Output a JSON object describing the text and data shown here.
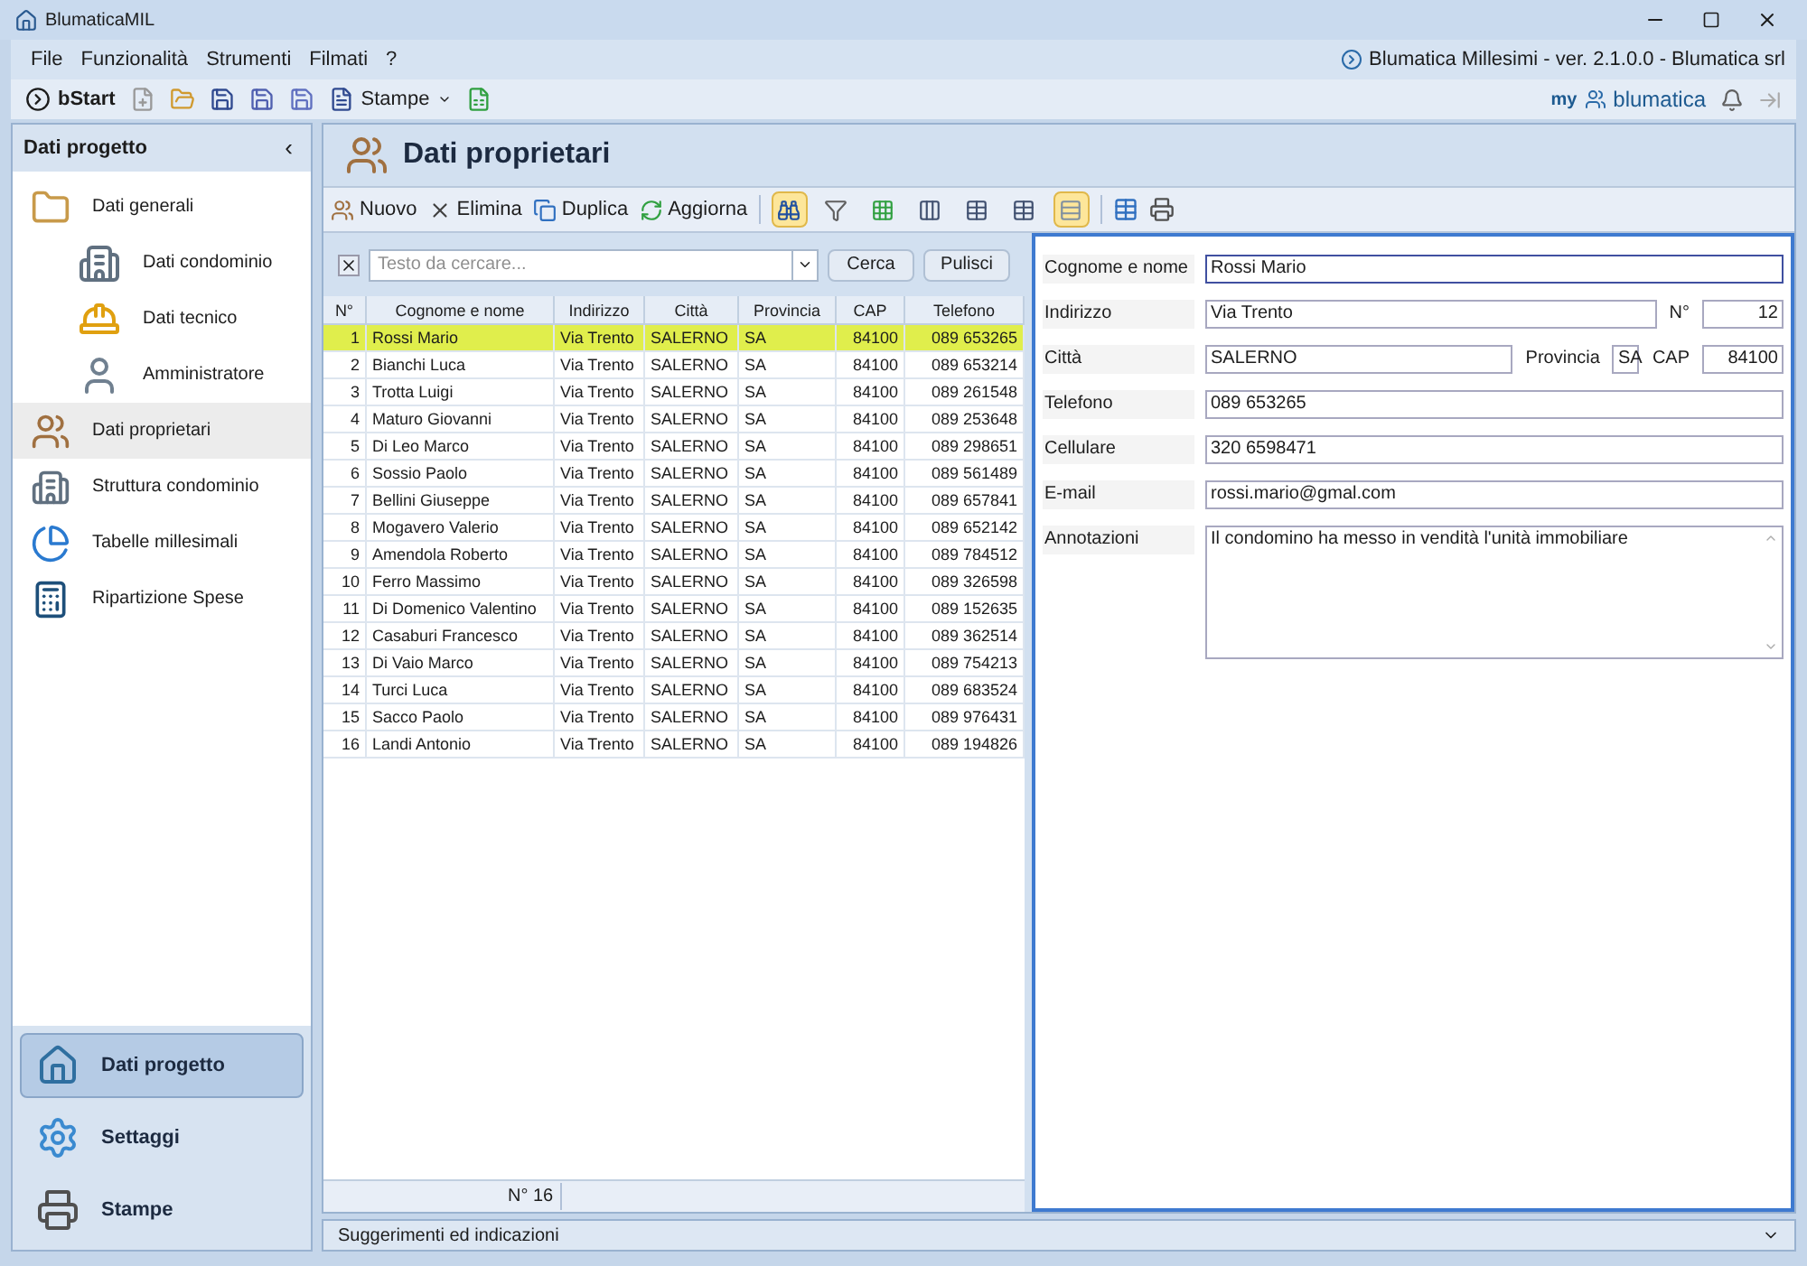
{
  "window": {
    "title": "BlumaticaMIL",
    "product": "Blumatica Millesimi - ver. 2.1.0.0 - Blumatica srl"
  },
  "menu": [
    "File",
    "Funzionalità",
    "Strumenti",
    "Filmati",
    "?"
  ],
  "toolbar": {
    "start": "bStart",
    "print": "Stampe",
    "brand_prefix": "my",
    "brand": "blumatica"
  },
  "sidebar": {
    "title": "Dati progetto",
    "collapse": "‹",
    "items": [
      {
        "label": "Dati generali",
        "kind": "folder",
        "selected": false,
        "children": [
          {
            "label": "Dati condominio",
            "kind": "building",
            "selected": false
          },
          {
            "label": "Dati tecnico",
            "kind": "worker",
            "selected": false
          },
          {
            "label": "Amministratore",
            "kind": "person",
            "selected": false
          }
        ]
      },
      {
        "label": "Dati proprietari",
        "kind": "people",
        "selected": true
      },
      {
        "label": "Struttura condominio",
        "kind": "building",
        "selected": false
      },
      {
        "label": "Tabelle millesimali",
        "kind": "pie",
        "selected": false
      },
      {
        "label": "Ripartizione Spese",
        "kind": "calc",
        "selected": false
      }
    ],
    "nav": [
      {
        "label": "Dati progetto",
        "kind": "home",
        "selected": true
      },
      {
        "label": "Settaggi",
        "kind": "gear",
        "selected": false
      },
      {
        "label": "Stampe",
        "kind": "printer",
        "selected": false
      }
    ]
  },
  "panel": {
    "title": "Dati proprietari",
    "actions": [
      {
        "label": "Nuovo",
        "kind": "people"
      },
      {
        "label": "Elimina",
        "kind": "x"
      },
      {
        "label": "Duplica",
        "kind": "copy"
      },
      {
        "label": "Aggiorna",
        "kind": "refresh"
      }
    ],
    "toggles": [
      {
        "kind": "binoculars",
        "selected": true
      },
      {
        "kind": "filter",
        "selected": false
      },
      {
        "kind": "grid",
        "selected": false
      },
      {
        "kind": "columns",
        "selected": false
      },
      {
        "kind": "table",
        "selected": false
      },
      {
        "kind": "table",
        "selected": false
      },
      {
        "kind": "rows",
        "selected": true
      }
    ],
    "search": {
      "placeholder": "Testo da cercare...",
      "buttons": [
        "Cerca",
        "Pulisci"
      ]
    },
    "table": {
      "columns": [
        "N°",
        "Cognome e nome",
        "Indirizzo",
        "Città",
        "Provincia",
        "CAP",
        "Telefono"
      ],
      "rows": [
        {
          "selected": true,
          "cells": [
            "1",
            "Rossi Mario",
            "Via Trento",
            "SALERNO",
            "SA",
            "84100",
            "089 653265"
          ]
        },
        {
          "selected": false,
          "cells": [
            "2",
            "Bianchi Luca",
            "Via Trento",
            "SALERNO",
            "SA",
            "84100",
            "089 653214"
          ]
        },
        {
          "selected": false,
          "cells": [
            "3",
            "Trotta Luigi",
            "Via Trento",
            "SALERNO",
            "SA",
            "84100",
            "089 261548"
          ]
        },
        {
          "selected": false,
          "cells": [
            "4",
            "Maturo Giovanni",
            "Via Trento",
            "SALERNO",
            "SA",
            "84100",
            "089 253648"
          ]
        },
        {
          "selected": false,
          "cells": [
            "5",
            "Di Leo Marco",
            "Via Trento",
            "SALERNO",
            "SA",
            "84100",
            "089 298651"
          ]
        },
        {
          "selected": false,
          "cells": [
            "6",
            "Sossio Paolo",
            "Via Trento",
            "SALERNO",
            "SA",
            "84100",
            "089 561489"
          ]
        },
        {
          "selected": false,
          "cells": [
            "7",
            "Bellini Giuseppe",
            "Via Trento",
            "SALERNO",
            "SA",
            "84100",
            "089 657841"
          ]
        },
        {
          "selected": false,
          "cells": [
            "8",
            "Mogavero Valerio",
            "Via Trento",
            "SALERNO",
            "SA",
            "84100",
            "089 652142"
          ]
        },
        {
          "selected": false,
          "cells": [
            "9",
            "Amendola Roberto",
            "Via Trento",
            "SALERNO",
            "SA",
            "84100",
            "089 784512"
          ]
        },
        {
          "selected": false,
          "cells": [
            "10",
            "Ferro Massimo",
            "Via Trento",
            "SALERNO",
            "SA",
            "84100",
            "089 326598"
          ]
        },
        {
          "selected": false,
          "cells": [
            "11",
            "Di Domenico Valentino",
            "Via Trento",
            "SALERNO",
            "SA",
            "84100",
            "089 152635"
          ]
        },
        {
          "selected": false,
          "cells": [
            "12",
            "Casaburi Francesco",
            "Via Trento",
            "SALERNO",
            "SA",
            "84100",
            "089 362514"
          ]
        },
        {
          "selected": false,
          "cells": [
            "13",
            "Di Vaio Marco",
            "Via Trento",
            "SALERNO",
            "SA",
            "84100",
            "089 754213"
          ]
        },
        {
          "selected": false,
          "cells": [
            "14",
            "Turci Luca",
            "Via Trento",
            "SALERNO",
            "SA",
            "84100",
            "089 683524"
          ]
        },
        {
          "selected": false,
          "cells": [
            "15",
            "Sacco Paolo",
            "Via Trento",
            "SALERNO",
            "SA",
            "84100",
            "089 976431"
          ]
        },
        {
          "selected": false,
          "cells": [
            "16",
            "Landi Antonio",
            "Via Trento",
            "SALERNO",
            "SA",
            "84100",
            "089 194826"
          ]
        }
      ],
      "footer": "N° 16"
    },
    "form": [
      [
        {
          "label": "Cognome e nome",
          "value": "Rossi Mario",
          "kind": "focused"
        }
      ],
      [
        {
          "label": "Indirizzo",
          "value": "Via Trento",
          "kind": "wide"
        },
        {
          "label": "N°",
          "value": "12",
          "kind": "number"
        }
      ],
      [
        {
          "label": "Città",
          "value": "SALERNO",
          "kind": "wide"
        },
        {
          "label": "Provincia",
          "value": "SA",
          "kind": "tiny"
        },
        {
          "label": "CAP",
          "value": "84100",
          "kind": "number"
        }
      ],
      [
        {
          "label": "Telefono",
          "value": "089 653265",
          "kind": "wide"
        }
      ],
      [
        {
          "label": "Cellulare",
          "value": "320 6598471",
          "kind": "wide"
        }
      ],
      [
        {
          "label": "E-mail",
          "value": "rossi.mario@gmal.com",
          "kind": "wide"
        }
      ],
      [
        {
          "label": "Annotazioni",
          "value": "Il condomino ha messo in vendità l'unità immobiliare",
          "kind": "note"
        }
      ]
    ]
  },
  "hints": "Suggerimenti ed indicazioni"
}
